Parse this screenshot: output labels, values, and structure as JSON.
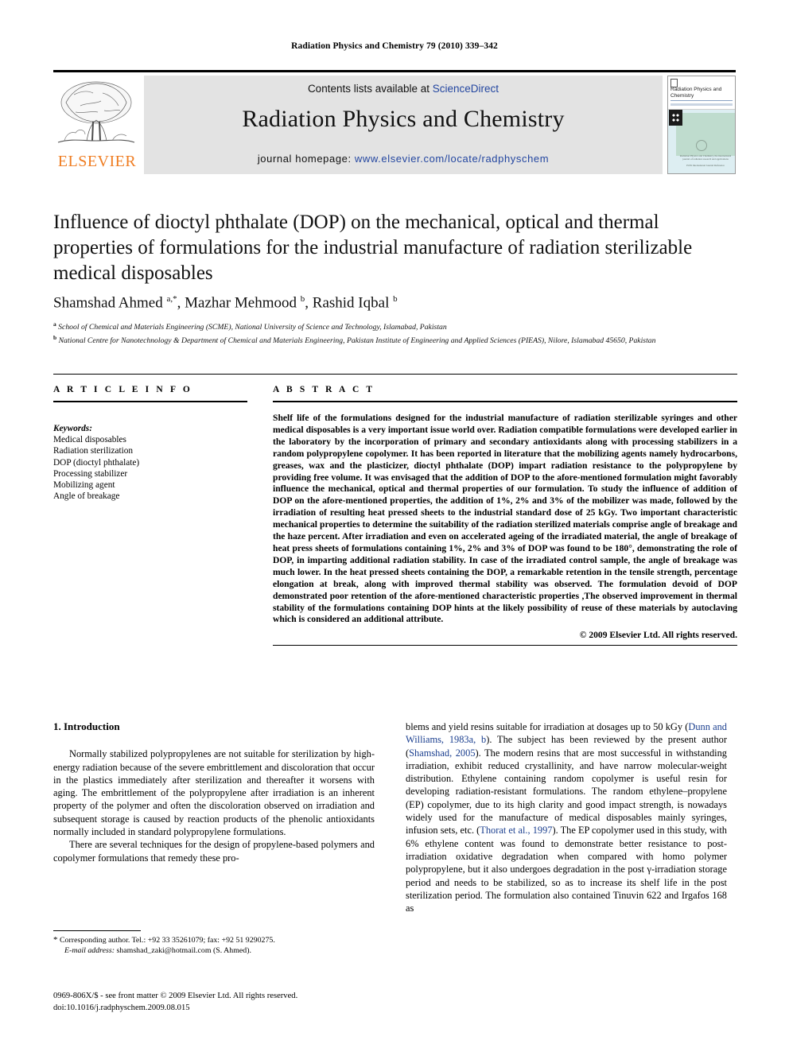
{
  "running_head": "Radiation Physics and Chemistry 79 (2010) 339–342",
  "masthead": {
    "contents_prefix": "Contents lists available at ",
    "sciencedirect": "ScienceDirect",
    "journal_title": "Radiation Physics and Chemistry",
    "homepage_prefix": "journal homepage: ",
    "homepage_url": "www.elsevier.com/locate/radphyschem",
    "publisher_logo_text": "ELSEVIER",
    "publisher_accent_color": "#ef7d22",
    "link_color": "#2346a0",
    "banner_bg": "#e3e3e3"
  },
  "cover": {
    "title": "Radiation Physics and Chemistry",
    "subtitle": "An International Journal of Radiation Physics, Radiation Chemistry and Radiation Processing",
    "caption": "Radiation Physics and Chemistry, the international journal of radiation research and applications",
    "footer": "ISSN International Journal Reference"
  },
  "article": {
    "title": "Influence of dioctyl phthalate (DOP) on the mechanical, optical and thermal properties of formulations for the industrial manufacture of radiation sterilizable medical disposables",
    "authors_html": "Shamshad Ahmed <sup>a,</sup><sup>*</sup>, Mazhar Mehmood <sup>b</sup>, Rashid Iqbal <sup>b</sup>",
    "affiliation_a": "School of Chemical and Materials Engineering (SCME), National University of Science and Technology, Islamabad, Pakistan",
    "affiliation_b": "National Centre for Nanotechnology & Department of Chemical and Materials Engineering, Pakistan Institute of Engineering and Applied Sciences (PIEAS), Nilore, Islamabad 45650, Pakistan"
  },
  "article_info": {
    "heading": "A R T I C L E   I N F O",
    "keywords_label": "Keywords:",
    "keywords": [
      "Medical disposables",
      "Radiation sterilization",
      "DOP (dioctyl phthalate)",
      "Processing stabilizer",
      "Mobilizing agent",
      "Angle of breakage"
    ]
  },
  "abstract": {
    "heading": "A B S T R A C T",
    "text": "Shelf life of the formulations designed for the industrial manufacture of radiation sterilizable syringes and other medical disposables is a very important issue world over. Radiation compatible formulations were developed earlier in the laboratory by the incorporation of primary and secondary antioxidants along with processing stabilizers in a random polypropylene copolymer. It has been reported in literature that the mobilizing agents namely hydrocarbons, greases, wax and the plasticizer, dioctyl phthalate (DOP) impart radiation resistance to the polypropylene by providing free volume. It was envisaged that the addition of DOP to the afore-mentioned formulation might favorably influence the mechanical, optical and thermal properties of our formulation. To study the influence of addition of DOP on the afore-mentioned properties, the addition of 1%, 2% and 3% of the mobilizer was made, followed by the irradiation of resulting heat pressed sheets to the industrial standard dose of 25 kGy. Two important characteristic mechanical properties to determine the suitability of the radiation sterilized materials comprise angle of breakage and the haze percent. After irradiation and even on accelerated ageing of the irradiated material, the angle of breakage of heat press sheets of formulations containing 1%, 2% and 3% of DOP was found to be 180°, demonstrating the role of DOP, in imparting additional radiation stability. In case of the irradiated control sample, the angle of breakage was much lower. In the heat pressed sheets containing the DOP, a remarkable retention in the tensile strength, percentage elongation at break, along with improved thermal stability was observed. The formulation devoid of DOP demonstrated poor retention of the afore-mentioned characteristic properties ,The observed improvement in thermal stability of the formulations containing DOP hints at the likely possibility of reuse of these materials by autoclaving which is considered an additional attribute.",
    "copyright": "© 2009 Elsevier Ltd. All rights reserved."
  },
  "introduction": {
    "heading": "1.  Introduction",
    "para1": "Normally stabilized polypropylenes are not suitable for sterilization by high-energy radiation because of the severe embrittlement and discoloration that occur in the plastics immediately after sterilization and thereafter it worsens with aging. The embrittlement of the polypropylene after irradiation is an inherent property of the polymer and often the discoloration observed on irradiation and subsequent storage is caused by reaction products of the phenolic antioxidants normally included in standard polypropylene formulations.",
    "para2_left": "There are several techniques for the design of propylene-based polymers and copolymer formulations that remedy these pro-",
    "para2_right_pre": "blems and yield resins suitable for irradiation at dosages up to 50 kGy (",
    "ref1": "Dunn and Williams, 1983a, b",
    "para2_right_mid": "). The subject has been reviewed by the present author (",
    "ref2": "Shamshad, 2005",
    "para2_right_post": "). The modern resins that are most successful in withstanding irradiation, exhibit reduced crystallinity, and have narrow molecular-weight distribution. Ethylene containing random copolymer is useful resin for developing radiation-resistant formulations. The random ethylene–propylene (EP) copolymer, due to its high clarity and good impact strength, is nowadays widely used for the manufacture of medical disposables mainly syringes, infusion sets, etc. (",
    "ref3": "Thorat et al., 1997",
    "para2_right_end": "). The EP copolymer used in this study, with 6% ethylene content was found to demonstrate better resistance to post-irradiation oxidative degradation when compared with homo polymer polypropylene, but it also undergoes degradation in the post γ-irradiation storage period and needs to be stabilized, so as to increase its shelf life in the post sterilization period. The formulation also contained Tinuvin 622 and Irgafos 168 as",
    "ref_color": "#1b3f8f"
  },
  "footnotes": {
    "corresponding": "Corresponding author. Tel.: +92 33 35261079; fax: +92 51 9290275.",
    "email_label": "E-mail address:",
    "email": "shamshad_zaki@hotmail.com (S. Ahmed)."
  },
  "imprint": {
    "issn_line": "0969-806X/$ - see front matter © 2009 Elsevier Ltd. All rights reserved.",
    "doi_line": "doi:10.1016/j.radphyschem.2009.08.015"
  }
}
